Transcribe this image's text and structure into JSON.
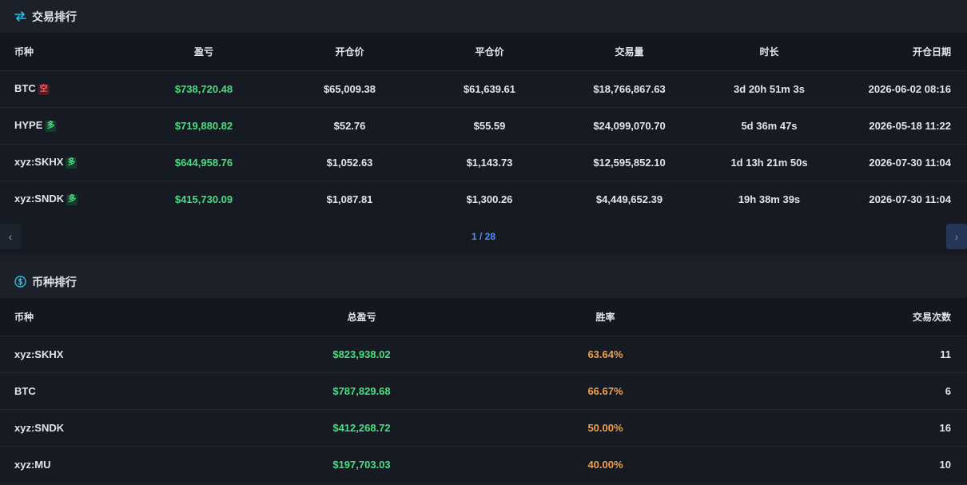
{
  "trades": {
    "title": "交易排行",
    "columns": [
      "币种",
      "盈亏",
      "开仓价",
      "平仓价",
      "交易量",
      "时长",
      "开仓日期"
    ],
    "rows": [
      {
        "coin": "BTC",
        "side": "空",
        "side_type": "short",
        "pnl": "$738,720.48",
        "open": "$65,009.38",
        "close": "$61,639.61",
        "volume": "$18,766,867.63",
        "duration": "3d 20h 51m 3s",
        "date": "2026-06-02 08:16"
      },
      {
        "coin": "HYPE",
        "side": "多",
        "side_type": "long",
        "pnl": "$719,880.82",
        "open": "$52.76",
        "close": "$55.59",
        "volume": "$24,099,070.70",
        "duration": "5d 36m 47s",
        "date": "2026-05-18 11:22"
      },
      {
        "coin": "xyz:SKHX",
        "side": "多",
        "side_type": "long",
        "pnl": "$644,958.76",
        "open": "$1,052.63",
        "close": "$1,143.73",
        "volume": "$12,595,852.10",
        "duration": "1d 13h 21m 50s",
        "date": "2026-07-30 11:04"
      },
      {
        "coin": "xyz:SNDK",
        "side": "多",
        "side_type": "long",
        "pnl": "$415,730.09",
        "open": "$1,087.81",
        "close": "$1,300.26",
        "volume": "$4,449,652.39",
        "duration": "19h 38m 39s",
        "date": "2026-07-30 11:04"
      }
    ],
    "pager": {
      "indicator": "1 / 28",
      "prev_glyph": "‹",
      "next_glyph": "›"
    }
  },
  "coins": {
    "title": "币种排行",
    "columns": [
      "币种",
      "总盈亏",
      "胜率",
      "交易次数"
    ],
    "rows": [
      {
        "coin": "xyz:SKHX",
        "total_pnl": "$823,938.02",
        "win_rate": "63.64%",
        "count": "11"
      },
      {
        "coin": "BTC",
        "total_pnl": "$787,829.68",
        "win_rate": "66.67%",
        "count": "6"
      },
      {
        "coin": "xyz:SNDK",
        "total_pnl": "$412,268.72",
        "win_rate": "50.00%",
        "count": "16"
      },
      {
        "coin": "xyz:MU",
        "total_pnl": "$197,703.03",
        "win_rate": "40.00%",
        "count": "10"
      }
    ]
  },
  "icons": {
    "trades": "swap-arrows-icon",
    "coins": "dollar-coin-icon"
  },
  "colors": {
    "accent": "#22c5e8",
    "profit": "#4ade80",
    "win_rate": "#f0a04b",
    "pager": "#4f8df5",
    "short": "#f25c6a"
  }
}
